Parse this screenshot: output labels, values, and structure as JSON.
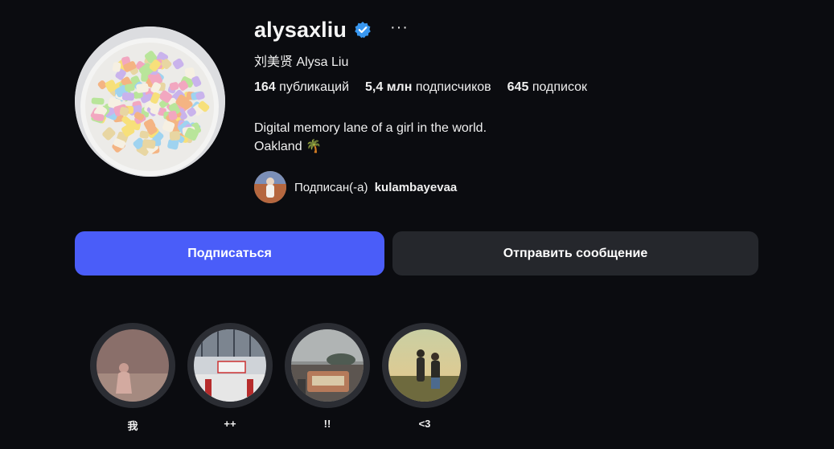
{
  "profile": {
    "username": "alysaxliu",
    "full_name": "刘美贤 Alysa Liu",
    "verified_icon": "verified-badge-icon",
    "more_icon": "more-dots-icon",
    "more_text": "···"
  },
  "stats": {
    "posts_count": "164",
    "posts_label": "публикаций",
    "followers_count": "5,4 млн",
    "followers_label": "подписчиков",
    "following_count": "645",
    "following_label": "подписок"
  },
  "bio": {
    "line1": "Digital memory lane of a girl in the world.",
    "line2": "Oakland 🌴"
  },
  "followed_by": {
    "prefix": "Подписан(-а)",
    "account": "kulambayevaa"
  },
  "actions": {
    "follow_label": "Подписаться",
    "message_label": "Отправить сообщение"
  },
  "highlights": [
    {
      "label": "我"
    },
    {
      "label": "++"
    },
    {
      "label": "!!"
    },
    {
      "label": "<3"
    }
  ],
  "colors": {
    "background": "#0b0c10",
    "follow_button": "#4a5df9",
    "message_button": "#25272c",
    "verified": "#3897f0"
  }
}
